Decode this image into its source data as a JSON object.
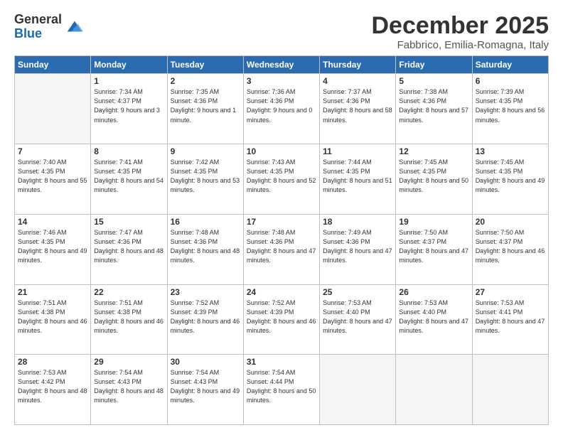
{
  "logo": {
    "general": "General",
    "blue": "Blue"
  },
  "header": {
    "month_title": "December 2025",
    "location": "Fabbrico, Emilia-Romagna, Italy"
  },
  "weekdays": [
    "Sunday",
    "Monday",
    "Tuesday",
    "Wednesday",
    "Thursday",
    "Friday",
    "Saturday"
  ],
  "weeks": [
    [
      {
        "day": "",
        "sunrise": "",
        "sunset": "",
        "daylight": ""
      },
      {
        "day": "1",
        "sunrise": "Sunrise: 7:34 AM",
        "sunset": "Sunset: 4:37 PM",
        "daylight": "Daylight: 9 hours and 3 minutes."
      },
      {
        "day": "2",
        "sunrise": "Sunrise: 7:35 AM",
        "sunset": "Sunset: 4:36 PM",
        "daylight": "Daylight: 9 hours and 1 minute."
      },
      {
        "day": "3",
        "sunrise": "Sunrise: 7:36 AM",
        "sunset": "Sunset: 4:36 PM",
        "daylight": "Daylight: 9 hours and 0 minutes."
      },
      {
        "day": "4",
        "sunrise": "Sunrise: 7:37 AM",
        "sunset": "Sunset: 4:36 PM",
        "daylight": "Daylight: 8 hours and 58 minutes."
      },
      {
        "day": "5",
        "sunrise": "Sunrise: 7:38 AM",
        "sunset": "Sunset: 4:36 PM",
        "daylight": "Daylight: 8 hours and 57 minutes."
      },
      {
        "day": "6",
        "sunrise": "Sunrise: 7:39 AM",
        "sunset": "Sunset: 4:35 PM",
        "daylight": "Daylight: 8 hours and 56 minutes."
      }
    ],
    [
      {
        "day": "7",
        "sunrise": "Sunrise: 7:40 AM",
        "sunset": "Sunset: 4:35 PM",
        "daylight": "Daylight: 8 hours and 55 minutes."
      },
      {
        "day": "8",
        "sunrise": "Sunrise: 7:41 AM",
        "sunset": "Sunset: 4:35 PM",
        "daylight": "Daylight: 8 hours and 54 minutes."
      },
      {
        "day": "9",
        "sunrise": "Sunrise: 7:42 AM",
        "sunset": "Sunset: 4:35 PM",
        "daylight": "Daylight: 8 hours and 53 minutes."
      },
      {
        "day": "10",
        "sunrise": "Sunrise: 7:43 AM",
        "sunset": "Sunset: 4:35 PM",
        "daylight": "Daylight: 8 hours and 52 minutes."
      },
      {
        "day": "11",
        "sunrise": "Sunrise: 7:44 AM",
        "sunset": "Sunset: 4:35 PM",
        "daylight": "Daylight: 8 hours and 51 minutes."
      },
      {
        "day": "12",
        "sunrise": "Sunrise: 7:45 AM",
        "sunset": "Sunset: 4:35 PM",
        "daylight": "Daylight: 8 hours and 50 minutes."
      },
      {
        "day": "13",
        "sunrise": "Sunrise: 7:45 AM",
        "sunset": "Sunset: 4:35 PM",
        "daylight": "Daylight: 8 hours and 49 minutes."
      }
    ],
    [
      {
        "day": "14",
        "sunrise": "Sunrise: 7:46 AM",
        "sunset": "Sunset: 4:35 PM",
        "daylight": "Daylight: 8 hours and 49 minutes."
      },
      {
        "day": "15",
        "sunrise": "Sunrise: 7:47 AM",
        "sunset": "Sunset: 4:36 PM",
        "daylight": "Daylight: 8 hours and 48 minutes."
      },
      {
        "day": "16",
        "sunrise": "Sunrise: 7:48 AM",
        "sunset": "Sunset: 4:36 PM",
        "daylight": "Daylight: 8 hours and 48 minutes."
      },
      {
        "day": "17",
        "sunrise": "Sunrise: 7:48 AM",
        "sunset": "Sunset: 4:36 PM",
        "daylight": "Daylight: 8 hours and 47 minutes."
      },
      {
        "day": "18",
        "sunrise": "Sunrise: 7:49 AM",
        "sunset": "Sunset: 4:36 PM",
        "daylight": "Daylight: 8 hours and 47 minutes."
      },
      {
        "day": "19",
        "sunrise": "Sunrise: 7:50 AM",
        "sunset": "Sunset: 4:37 PM",
        "daylight": "Daylight: 8 hours and 47 minutes."
      },
      {
        "day": "20",
        "sunrise": "Sunrise: 7:50 AM",
        "sunset": "Sunset: 4:37 PM",
        "daylight": "Daylight: 8 hours and 46 minutes."
      }
    ],
    [
      {
        "day": "21",
        "sunrise": "Sunrise: 7:51 AM",
        "sunset": "Sunset: 4:38 PM",
        "daylight": "Daylight: 8 hours and 46 minutes."
      },
      {
        "day": "22",
        "sunrise": "Sunrise: 7:51 AM",
        "sunset": "Sunset: 4:38 PM",
        "daylight": "Daylight: 8 hours and 46 minutes."
      },
      {
        "day": "23",
        "sunrise": "Sunrise: 7:52 AM",
        "sunset": "Sunset: 4:39 PM",
        "daylight": "Daylight: 8 hours and 46 minutes."
      },
      {
        "day": "24",
        "sunrise": "Sunrise: 7:52 AM",
        "sunset": "Sunset: 4:39 PM",
        "daylight": "Daylight: 8 hours and 46 minutes."
      },
      {
        "day": "25",
        "sunrise": "Sunrise: 7:53 AM",
        "sunset": "Sunset: 4:40 PM",
        "daylight": "Daylight: 8 hours and 47 minutes."
      },
      {
        "day": "26",
        "sunrise": "Sunrise: 7:53 AM",
        "sunset": "Sunset: 4:40 PM",
        "daylight": "Daylight: 8 hours and 47 minutes."
      },
      {
        "day": "27",
        "sunrise": "Sunrise: 7:53 AM",
        "sunset": "Sunset: 4:41 PM",
        "daylight": "Daylight: 8 hours and 47 minutes."
      }
    ],
    [
      {
        "day": "28",
        "sunrise": "Sunrise: 7:53 AM",
        "sunset": "Sunset: 4:42 PM",
        "daylight": "Daylight: 8 hours and 48 minutes."
      },
      {
        "day": "29",
        "sunrise": "Sunrise: 7:54 AM",
        "sunset": "Sunset: 4:43 PM",
        "daylight": "Daylight: 8 hours and 48 minutes."
      },
      {
        "day": "30",
        "sunrise": "Sunrise: 7:54 AM",
        "sunset": "Sunset: 4:43 PM",
        "daylight": "Daylight: 8 hours and 49 minutes."
      },
      {
        "day": "31",
        "sunrise": "Sunrise: 7:54 AM",
        "sunset": "Sunset: 4:44 PM",
        "daylight": "Daylight: 8 hours and 50 minutes."
      },
      {
        "day": "",
        "sunrise": "",
        "sunset": "",
        "daylight": ""
      },
      {
        "day": "",
        "sunrise": "",
        "sunset": "",
        "daylight": ""
      },
      {
        "day": "",
        "sunrise": "",
        "sunset": "",
        "daylight": ""
      }
    ]
  ]
}
